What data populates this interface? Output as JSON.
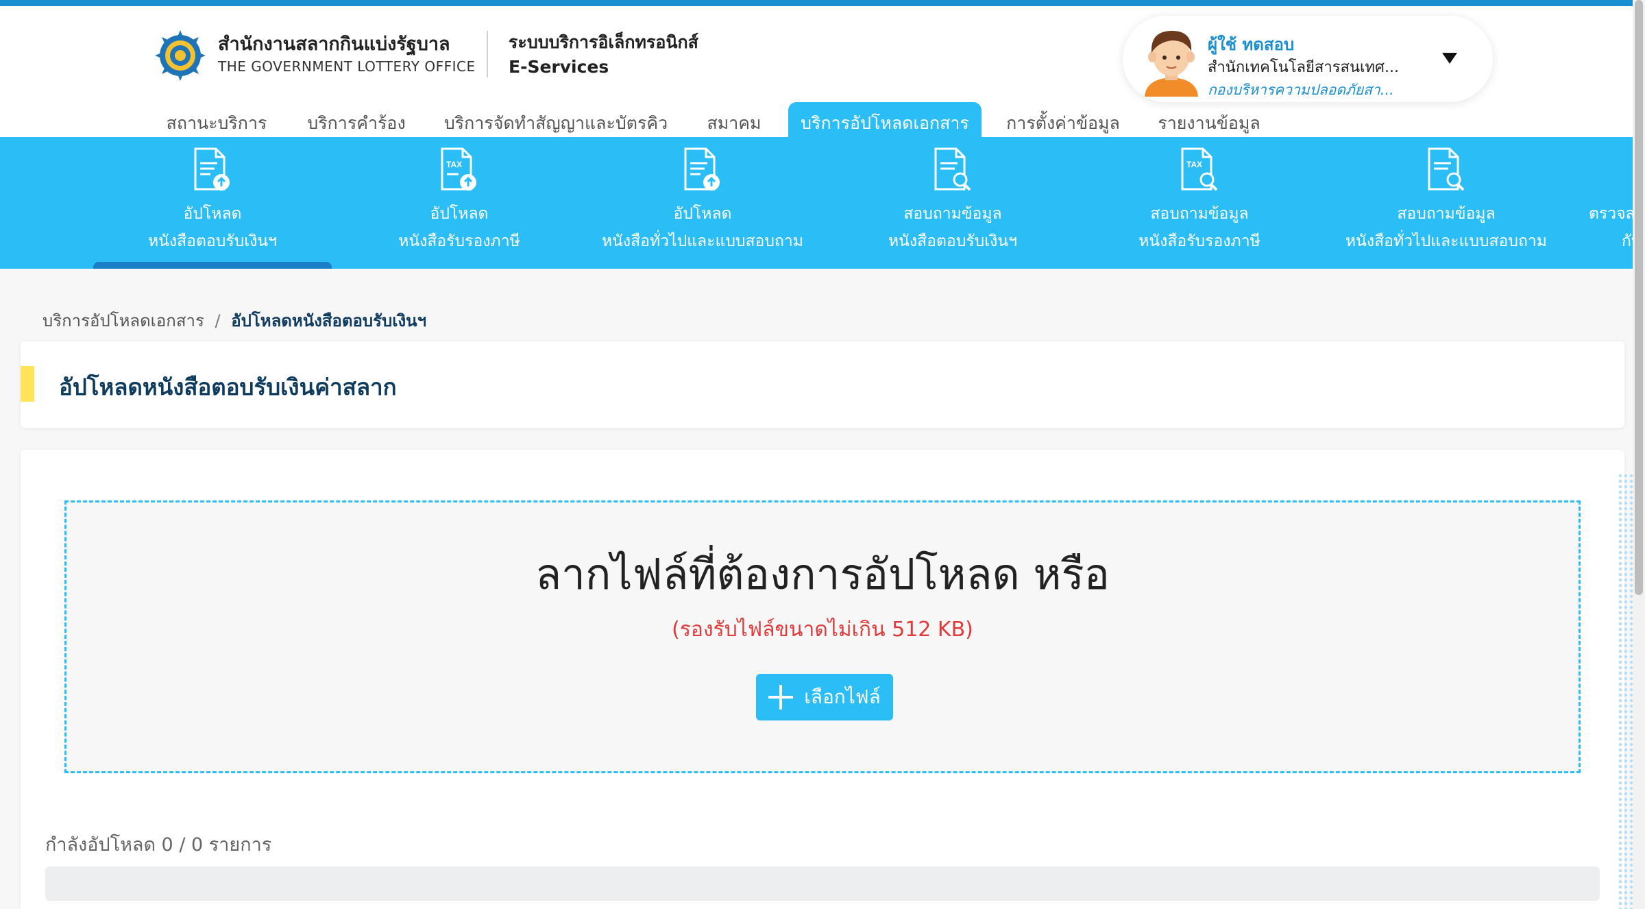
{
  "header": {
    "org_name_th": "สำนักงานสลากกินแบ่งรัฐบาล",
    "org_name_en": "THE GOVERNMENT LOTTERY OFFICE",
    "system_name_th": "ระบบบริการอิเล็กทรอนิกส์",
    "system_name_en": "E-Services"
  },
  "user": {
    "name": "ผู้ใช้ ทดสอบ",
    "department": "สำนักเทคโนโลยีสารสนเทศ...",
    "division": "กองบริหารความปลอดภัยสา..."
  },
  "main_nav": [
    {
      "label": "สถานะบริการ",
      "active": false
    },
    {
      "label": "บริการคำร้อง",
      "active": false
    },
    {
      "label": "บริการจัดทำสัญญาและบัตรคิว",
      "active": false
    },
    {
      "label": "สมาคม",
      "active": false
    },
    {
      "label": "บริการอัปโหลดเอกสาร",
      "active": true
    },
    {
      "label": "การตั้งค่าข้อมูล",
      "active": false
    },
    {
      "label": "รายงานข้อมูล",
      "active": false
    }
  ],
  "sub_nav": [
    {
      "line1": "อัปโหลด",
      "line2": "หนังสือตอบรับเงินฯ",
      "icon": "document-upload-icon",
      "active": true
    },
    {
      "line1": "อัปโหลด",
      "line2": "หนังสือรับรองภาษี",
      "icon": "tax-document-upload-icon",
      "badge": "TAX"
    },
    {
      "line1": "อัปโหลด",
      "line2": "หนังสือทั่วไปและแบบสอบถาม",
      "icon": "document-upload-icon"
    },
    {
      "line1": "สอบถามข้อมูล",
      "line2": "หนังสือตอบรับเงินฯ",
      "icon": "document-search-icon"
    },
    {
      "line1": "สอบถามข้อมูล",
      "line2": "หนังสือรับรองภาษี",
      "icon": "tax-document-search-icon",
      "badge": "TAX"
    },
    {
      "line1": "สอบถามข้อมูล",
      "line2": "หนังสือทั่วไปและแบบสอบถาม",
      "icon": "document-search-icon"
    },
    {
      "line1": "ตรวจสอ",
      "line2": "กับ",
      "icon": "document-check-icon"
    }
  ],
  "breadcrumb": {
    "parent": "บริการอัปโหลดเอกสาร",
    "separator": "/",
    "current": "อัปโหลดหนังสือตอบรับเงินฯ"
  },
  "page": {
    "title": "อัปโหลดหนังสือตอบรับเงินค่าสลาก"
  },
  "upload": {
    "drop_text": "ลากไฟล์ที่ต้องการอัปโหลด หรือ",
    "size_note": "(รองรับไฟล์ขนาดไม่เกิน 512 KB)",
    "button_label": "เลือกไฟล์",
    "progress_text": "กำลังอัปโหลด 0 / 0 รายการ",
    "progress_fraction": 0
  },
  "colors": {
    "brand_blue": "#2bbdf5",
    "dark_blue": "#1b7fc8",
    "title_navy": "#0f3b5f",
    "accent_yellow": "#ffe35a",
    "note_red": "#e03a3a"
  }
}
